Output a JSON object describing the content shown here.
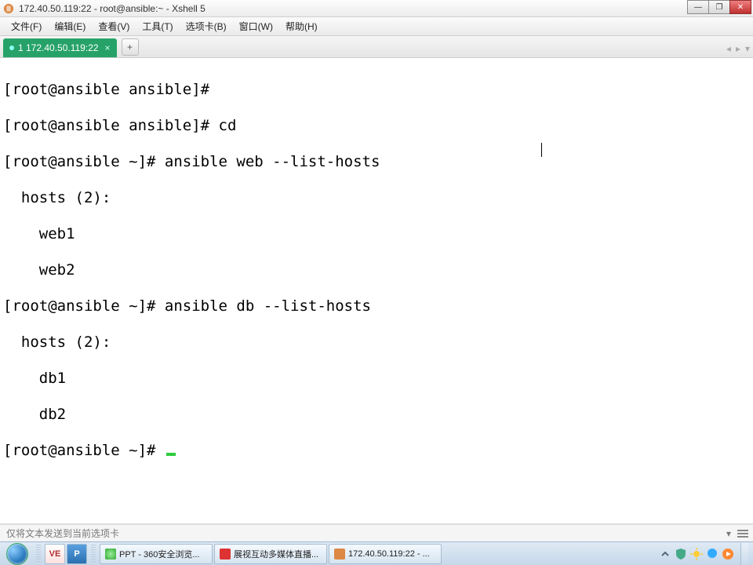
{
  "titlebar": {
    "title": "172.40.50.119:22 - root@ansible:~ - Xshell 5"
  },
  "menu": {
    "file": "文件(F)",
    "edit": "编辑(E)",
    "view": "查看(V)",
    "tools": "工具(T)",
    "tabs": "选项卡(B)",
    "window": "窗口(W)",
    "help": "帮助(H)"
  },
  "tab": {
    "label": "1 172.40.50.119:22",
    "close": "×",
    "add": "+"
  },
  "terminal": {
    "l1": "[root@ansible ansible]#",
    "l2": "[root@ansible ansible]# cd",
    "l3": "[root@ansible ~]# ansible web --list-hosts",
    "l4": "  hosts (2):",
    "l5": "    web1",
    "l6": "    web2",
    "l7": "[root@ansible ~]# ansible db --list-hosts",
    "l8": "  hosts (2):",
    "l9": "    db1",
    "l10": "    db2",
    "l11": "[root@ansible ~]# "
  },
  "status": {
    "text": "仅将文本发送到当前选项卡",
    "dropdown": "▾"
  },
  "taskbar": {
    "ve": "VE",
    "p": "P",
    "ppt": "PPT - 360安全浏览...",
    "live": "展视互动多媒体直播...",
    "xshell": "172.40.50.119:22 - ..."
  },
  "icons": {
    "min": "—",
    "max": "❐",
    "close": "✕",
    "left": "◂",
    "right": "▸",
    "down": "▾"
  }
}
